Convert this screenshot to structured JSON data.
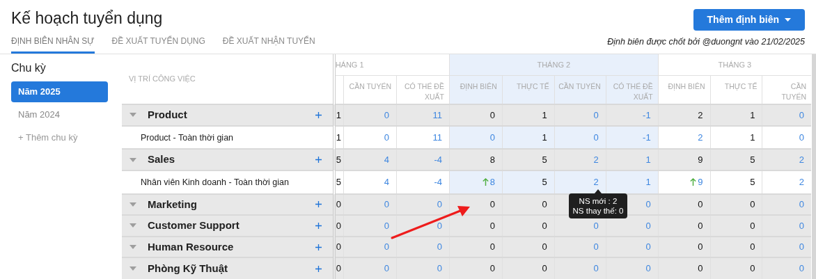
{
  "title": "Kế hoạch tuyển dụng",
  "add_button": {
    "label": "Thêm định biên"
  },
  "tabs": [
    {
      "label": "ĐỊNH BIÊN NHÂN SỰ",
      "selected": true
    },
    {
      "label": "ĐỀ XUẤT TUYỂN DỤNG",
      "selected": false
    },
    {
      "label": "ĐỀ XUẤT NHẬN TUYỂN",
      "selected": false
    }
  ],
  "note": "Định biên được chốt bởi @duongnt vào 21/02/2025",
  "sidebar": {
    "heading": "Chu kỳ",
    "items": [
      {
        "label": "Năm 2025",
        "selected": true
      },
      {
        "label": "Năm 2024",
        "selected": false
      }
    ],
    "add_link": "+ Thêm chu kỳ"
  },
  "table": {
    "job_header": "VỊ TRÍ CÔNG VIỆC",
    "months": [
      {
        "label": "HÁNG 1",
        "highlighted": false,
        "columns": [
          "CẦN TUYỂN",
          "CÓ THỂ ĐỀ XUẤT"
        ]
      },
      {
        "label": "THÁNG 2",
        "highlighted": true,
        "columns": [
          "ĐỊNH BIÊN",
          "THỰC TẾ",
          "CẦN TUYỂN",
          "CÓ THỂ ĐỀ XUẤT"
        ]
      },
      {
        "label": "THÁNG 3",
        "highlighted": false,
        "columns": [
          "ĐỊNH BIÊN",
          "THỰC TẾ",
          "CẦN TUYỂN"
        ]
      }
    ],
    "rows": [
      {
        "kind": "group",
        "name": "Product",
        "cells": [
          {
            "value": "1",
            "link": false,
            "increased": false
          },
          {
            "value": "0",
            "link": true,
            "increased": false
          },
          {
            "value": "11",
            "link": true,
            "increased": false
          },
          {
            "value": "0",
            "link": false,
            "increased": false
          },
          {
            "value": "1",
            "link": false,
            "increased": false
          },
          {
            "value": "0",
            "link": true,
            "increased": false
          },
          {
            "value": "-1",
            "link": true,
            "increased": false
          },
          {
            "value": "2",
            "link": false,
            "increased": false
          },
          {
            "value": "1",
            "link": false,
            "increased": false
          },
          {
            "value": "0",
            "link": true,
            "increased": false
          }
        ]
      },
      {
        "kind": "position",
        "name": "Product - Toàn thời gian",
        "cells": [
          {
            "value": "1",
            "link": false,
            "increased": false
          },
          {
            "value": "0",
            "link": true,
            "increased": false
          },
          {
            "value": "11",
            "link": true,
            "increased": false
          },
          {
            "value": "0",
            "link": true,
            "increased": false
          },
          {
            "value": "1",
            "link": false,
            "increased": false
          },
          {
            "value": "0",
            "link": true,
            "increased": false
          },
          {
            "value": "-1",
            "link": true,
            "increased": false
          },
          {
            "value": "2",
            "link": true,
            "increased": false
          },
          {
            "value": "1",
            "link": false,
            "increased": false
          },
          {
            "value": "0",
            "link": true,
            "increased": false
          }
        ]
      },
      {
        "kind": "group",
        "name": "Sales",
        "cells": [
          {
            "value": "5",
            "link": false,
            "increased": false
          },
          {
            "value": "4",
            "link": true,
            "increased": false
          },
          {
            "value": "-4",
            "link": true,
            "increased": false
          },
          {
            "value": "8",
            "link": false,
            "increased": false
          },
          {
            "value": "5",
            "link": false,
            "increased": false
          },
          {
            "value": "2",
            "link": true,
            "increased": false
          },
          {
            "value": "1",
            "link": true,
            "increased": false
          },
          {
            "value": "9",
            "link": false,
            "increased": false
          },
          {
            "value": "5",
            "link": false,
            "increased": false
          },
          {
            "value": "2",
            "link": true,
            "increased": false
          }
        ]
      },
      {
        "kind": "position",
        "name": "Nhân viên Kinh doanh - Toàn thời gian",
        "cells": [
          {
            "value": "5",
            "link": false,
            "increased": false
          },
          {
            "value": "4",
            "link": true,
            "increased": false
          },
          {
            "value": "-4",
            "link": true,
            "increased": false
          },
          {
            "value": "8",
            "link": true,
            "increased": true
          },
          {
            "value": "5",
            "link": false,
            "increased": false
          },
          {
            "value": "2",
            "link": true,
            "increased": false
          },
          {
            "value": "1",
            "link": true,
            "increased": false
          },
          {
            "value": "9",
            "link": true,
            "increased": true
          },
          {
            "value": "5",
            "link": false,
            "increased": false
          },
          {
            "value": "2",
            "link": true,
            "increased": false
          }
        ]
      },
      {
        "kind": "group",
        "name": "Marketing",
        "cells": [
          {
            "value": "0",
            "link": false,
            "increased": false
          },
          {
            "value": "0",
            "link": true,
            "increased": false
          },
          {
            "value": "0",
            "link": true,
            "increased": false
          },
          {
            "value": "0",
            "link": false,
            "increased": false
          },
          {
            "value": "0",
            "link": false,
            "increased": false
          },
          null,
          {
            "value": "0",
            "link": true,
            "increased": false
          },
          {
            "value": "0",
            "link": false,
            "increased": false
          },
          {
            "value": "0",
            "link": false,
            "increased": false
          },
          {
            "value": "0",
            "link": true,
            "increased": false
          }
        ]
      },
      {
        "kind": "group",
        "name": "Customer Support",
        "cells": [
          {
            "value": "0",
            "link": false,
            "increased": false
          },
          {
            "value": "0",
            "link": true,
            "increased": false
          },
          {
            "value": "0",
            "link": true,
            "increased": false
          },
          {
            "value": "0",
            "link": false,
            "increased": false
          },
          {
            "value": "0",
            "link": false,
            "increased": false
          },
          {
            "value": "0",
            "link": true,
            "increased": false
          },
          {
            "value": "0",
            "link": true,
            "increased": false
          },
          {
            "value": "0",
            "link": false,
            "increased": false
          },
          {
            "value": "0",
            "link": false,
            "increased": false
          },
          {
            "value": "0",
            "link": true,
            "increased": false
          }
        ]
      },
      {
        "kind": "group",
        "name": "Human Resource",
        "cells": [
          {
            "value": "0",
            "link": false,
            "increased": false
          },
          {
            "value": "0",
            "link": true,
            "increased": false
          },
          {
            "value": "0",
            "link": true,
            "increased": false
          },
          {
            "value": "0",
            "link": false,
            "increased": false
          },
          {
            "value": "0",
            "link": false,
            "increased": false
          },
          {
            "value": "0",
            "link": true,
            "increased": false
          },
          {
            "value": "0",
            "link": true,
            "increased": false
          },
          {
            "value": "0",
            "link": false,
            "increased": false
          },
          {
            "value": "0",
            "link": false,
            "increased": false
          },
          {
            "value": "0",
            "link": true,
            "increased": false
          }
        ]
      },
      {
        "kind": "group",
        "name": "Phòng Kỹ Thuật",
        "cells": [
          {
            "value": "0",
            "link": false,
            "increased": false
          },
          {
            "value": "0",
            "link": true,
            "increased": false
          },
          {
            "value": "0",
            "link": true,
            "increased": false
          },
          {
            "value": "0",
            "link": false,
            "increased": false
          },
          {
            "value": "0",
            "link": false,
            "increased": false
          },
          {
            "value": "0",
            "link": true,
            "increased": false
          },
          {
            "value": "0",
            "link": true,
            "increased": false
          },
          {
            "value": "0",
            "link": false,
            "increased": false
          },
          {
            "value": "0",
            "link": false,
            "increased": false
          },
          {
            "value": "0",
            "link": true,
            "increased": false
          }
        ]
      }
    ]
  },
  "tooltip": {
    "lines": [
      "NS mới : 2",
      "NS thay thế: 0"
    ]
  }
}
